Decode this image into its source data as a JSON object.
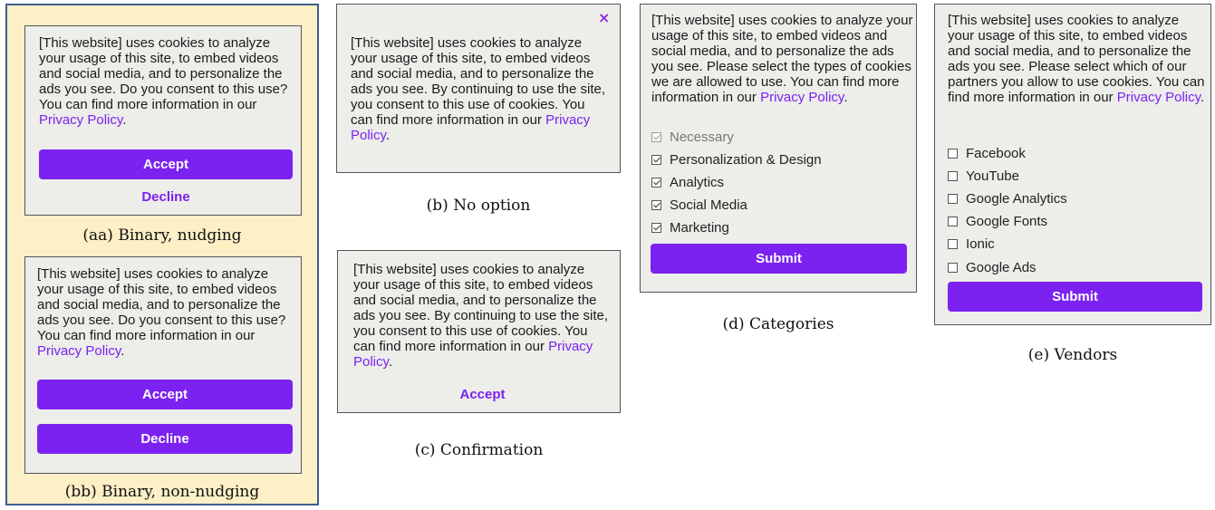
{
  "colors": {
    "accent": "#7b22f0",
    "banner_bg": "#ededea",
    "highlight_bg": "#fdefc6",
    "frame": "#3f5f8c"
  },
  "text": {
    "consent_question": "[This website] uses cookies to analyze your usage of this site, to embed videos and social media, and to personalize the ads you see. Do you consent to this use? You can find more information in our",
    "no_option": "[This website] uses cookies to analyze your usage of this site, to embed videos and social media, and to personalize the ads you see. By continuing to use the site, you consent to this use of cookies. You can find more information in our",
    "categories_intro": "[This website] uses cookies to analyze your usage of this site, to embed videos and social media, and to personalize the ads you see. Please select the types of cookies we are allowed to use. You can find more information in our",
    "vendors_intro": "[This website] uses cookies to analyze your usage of this site, to embed videos and social media, and to personalize the ads you see. Please select which of our partners you allow to use cookies. You can find more information in our",
    "privacy_link": "Privacy Policy",
    "period": "."
  },
  "buttons": {
    "accept": "Accept",
    "decline": "Decline",
    "submit": "Submit",
    "close_glyph": "×"
  },
  "captions": {
    "aa": "(aa) Binary, nudging",
    "bb": "(bb) Binary, non-nudging",
    "b": "(b) No option",
    "c": "(c) Confirmation",
    "d": "(d) Categories",
    "e": "(e) Vendors"
  },
  "categories": [
    {
      "label": "Necessary",
      "checked": true,
      "disabled": true
    },
    {
      "label": "Personalization & Design",
      "checked": true,
      "disabled": false
    },
    {
      "label": "Analytics",
      "checked": true,
      "disabled": false
    },
    {
      "label": "Social Media",
      "checked": true,
      "disabled": false
    },
    {
      "label": "Marketing",
      "checked": true,
      "disabled": false
    }
  ],
  "vendors": [
    {
      "label": "Facebook",
      "checked": false
    },
    {
      "label": "YouTube",
      "checked": false
    },
    {
      "label": "Google Analytics",
      "checked": false
    },
    {
      "label": "Google Fonts",
      "checked": false
    },
    {
      "label": "Ionic",
      "checked": false
    },
    {
      "label": "Google Ads",
      "checked": false
    }
  ]
}
